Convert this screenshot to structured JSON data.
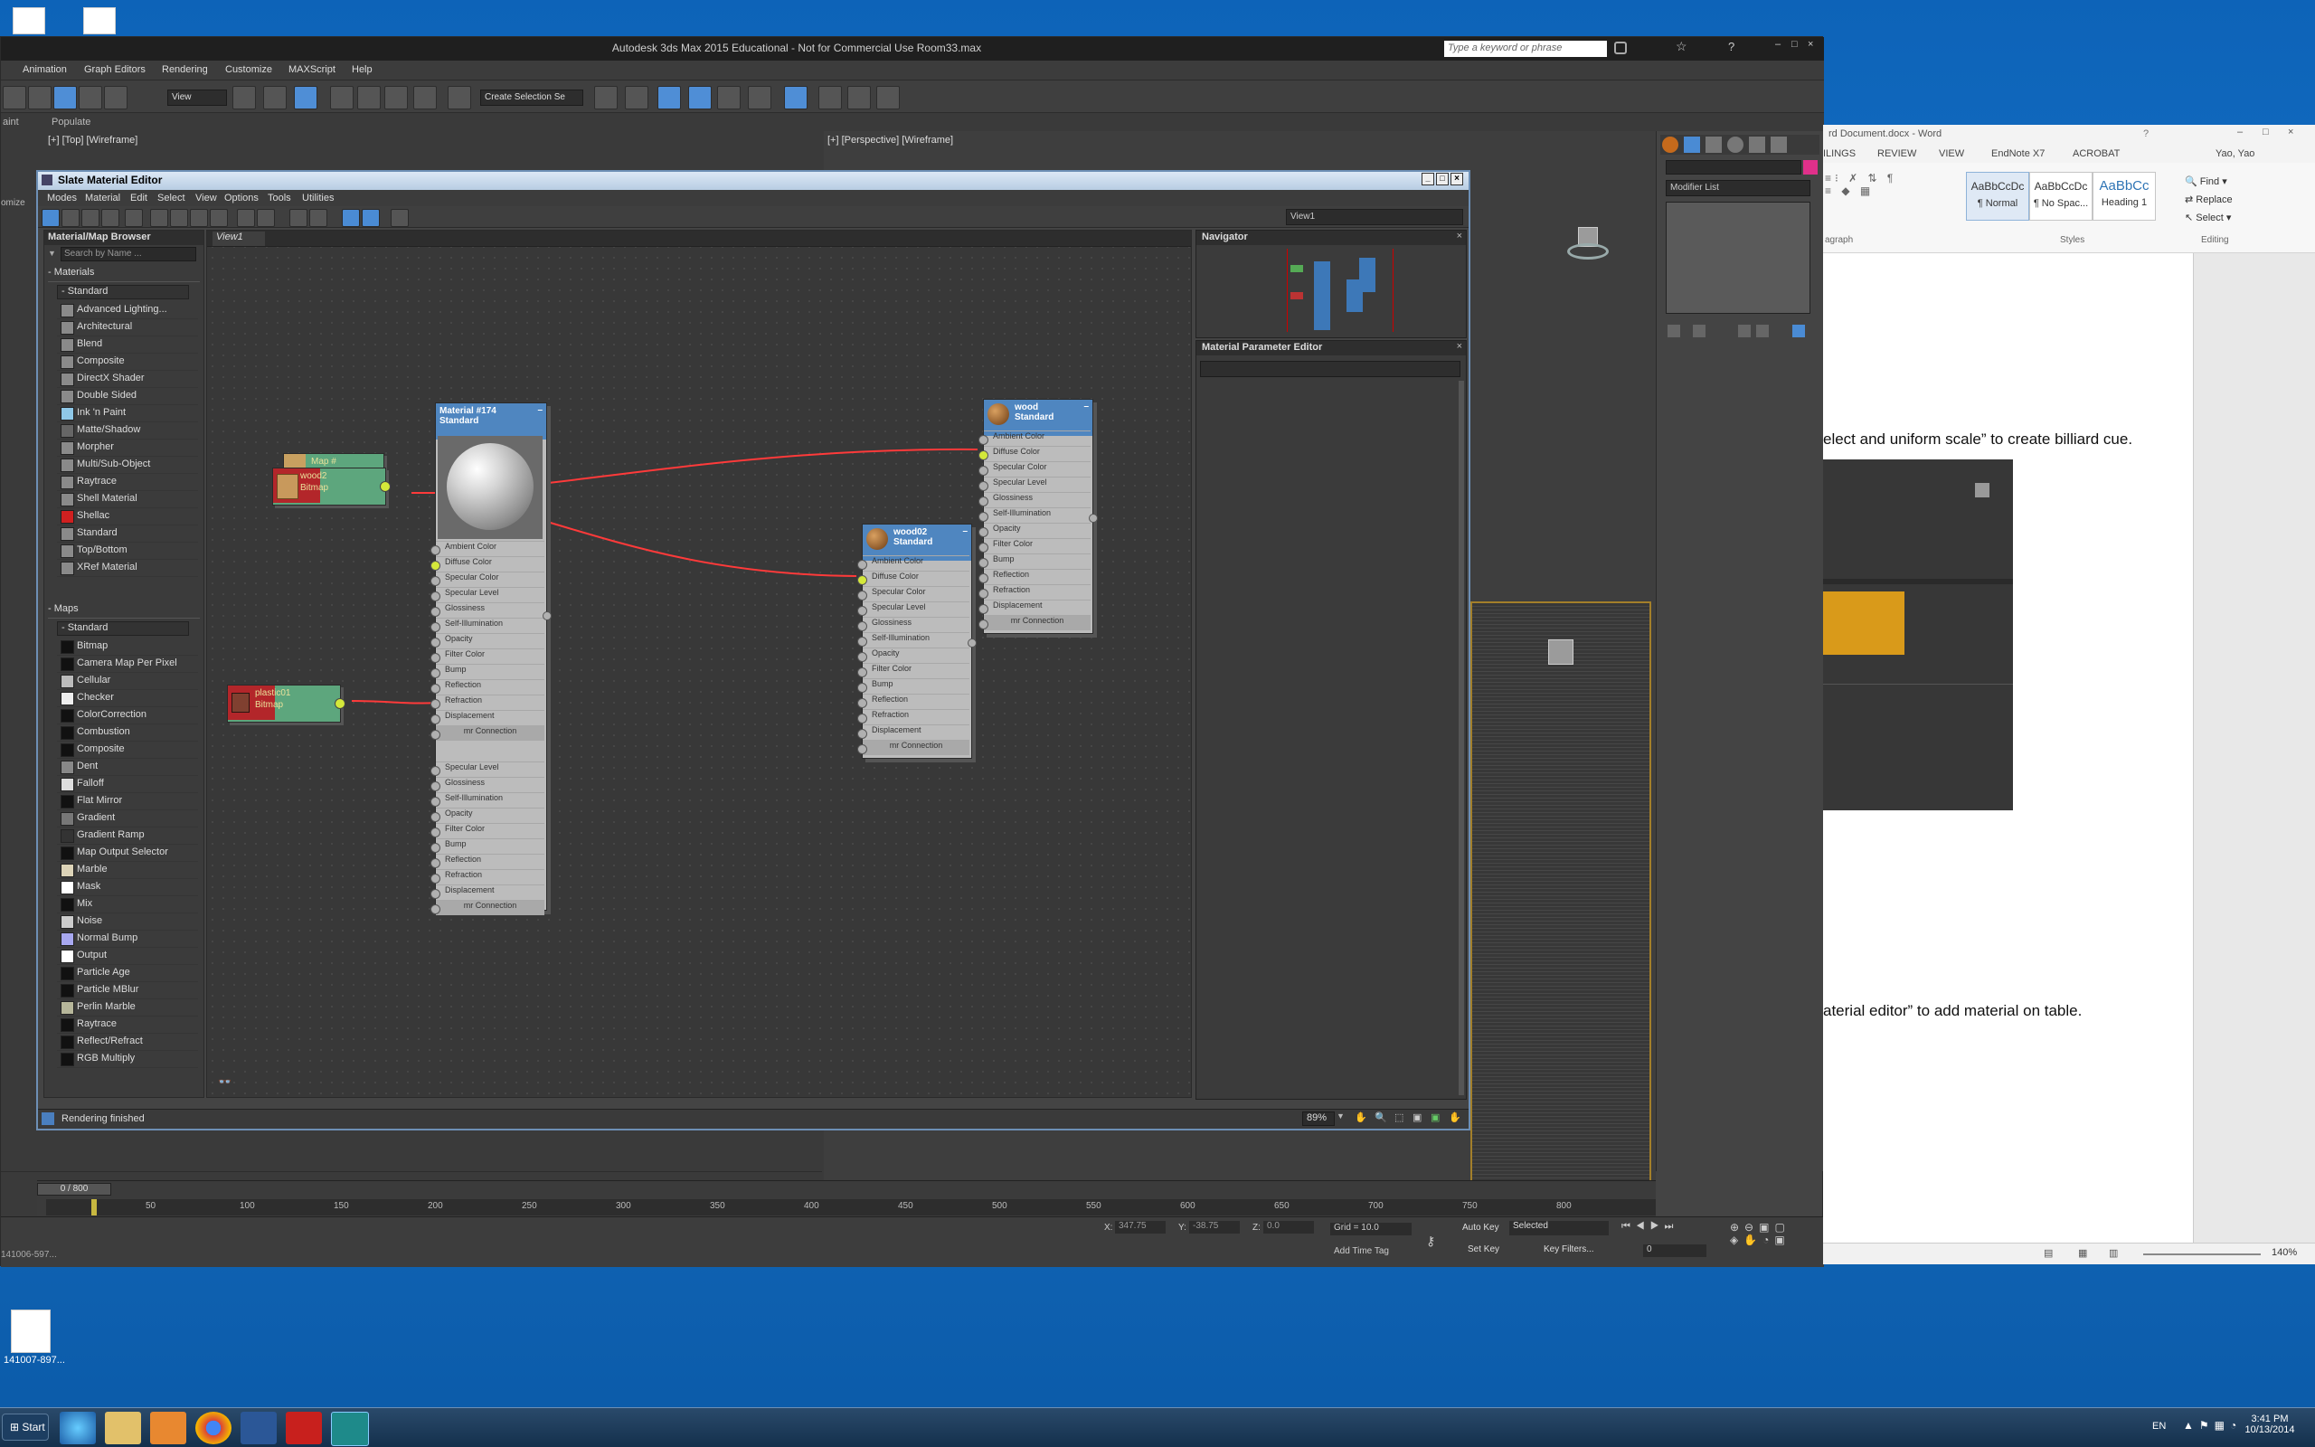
{
  "desktop": {
    "icons": [
      {
        "label": ""
      },
      {
        "label": ""
      },
      {
        "label": "141007-897..."
      }
    ]
  },
  "max": {
    "title": "Autodesk 3ds Max  2015  Educational - Not for Commercial Use    Room33.max",
    "search_placeholder": "Type a keyword or phrase",
    "menu": [
      "Animation",
      "Graph Editors",
      "Rendering",
      "Customize",
      "MAXScript",
      "Help"
    ],
    "ref_coord": "View",
    "selection_set": "Create Selection Se",
    "ribbon": [
      "aint",
      "Populate"
    ],
    "viewport_top_label": "[+] [Top] [Wireframe]",
    "viewport_persp_label": "[+] [Perspective] [Wireframe]",
    "side_label": "omize",
    "modifier_list": "Modifier List",
    "time_slider": "0 / 800",
    "ruler": [
      "50",
      "100",
      "150",
      "200",
      "250",
      "300",
      "350",
      "400",
      "450",
      "500",
      "550",
      "600",
      "650",
      "700",
      "750",
      "800"
    ],
    "status": {
      "x_label": "X:",
      "x_val": "347.75",
      "y_label": "Y:",
      "y_val": "-38.75",
      "z_label": "Z:",
      "z_val": "0.0",
      "grid": "Grid = 10.0",
      "auto_key": "Auto Key",
      "auto_key_val": "Selected",
      "set_key": "Set Key",
      "key_filters": "Key Filters...",
      "add_time_tag": "Add Time Tag",
      "frame": "0",
      "left_text": "141006-597..."
    }
  },
  "slate": {
    "title": "Slate Material Editor",
    "menu": [
      "Modes",
      "Material",
      "Edit",
      "Select",
      "View",
      "Options",
      "Tools",
      "Utilities"
    ],
    "view_dropdown": "View1",
    "browser": {
      "title": "Material/Map Browser",
      "search": "Search by Name ...",
      "materials_header": "- Materials",
      "materials_group": "- Standard",
      "materials": [
        {
          "name": "Advanced Lighting...",
          "color": "#8a8a8a"
        },
        {
          "name": "Architectural",
          "color": "#8a8a8a"
        },
        {
          "name": "Blend",
          "color": "#8a8a8a"
        },
        {
          "name": "Composite",
          "color": "#8a8a8a"
        },
        {
          "name": "DirectX Shader",
          "color": "#8a8a8a"
        },
        {
          "name": "Double Sided",
          "color": "#8a8a8a"
        },
        {
          "name": "Ink 'n Paint",
          "color": "#8fc8e8"
        },
        {
          "name": "Matte/Shadow",
          "color": "#666666"
        },
        {
          "name": "Morpher",
          "color": "#8a8a8a"
        },
        {
          "name": "Multi/Sub-Object",
          "color": "#8a8a8a"
        },
        {
          "name": "Raytrace",
          "color": "#8a8a8a"
        },
        {
          "name": "Shell Material",
          "color": "#8a8a8a"
        },
        {
          "name": "Shellac",
          "color": "#d02020"
        },
        {
          "name": "Standard",
          "color": "#8a8a8a"
        },
        {
          "name": "Top/Bottom",
          "color": "#8a8a8a"
        },
        {
          "name": "XRef Material",
          "color": "#8a8a8a"
        }
      ],
      "maps_header": "- Maps",
      "maps_group": "- Standard",
      "maps": [
        {
          "name": "Bitmap",
          "color": "#111111"
        },
        {
          "name": "Camera Map Per Pixel",
          "color": "#111111"
        },
        {
          "name": "Cellular",
          "color": "#bbbbbb"
        },
        {
          "name": "Checker",
          "color": "#eeeeee"
        },
        {
          "name": "ColorCorrection",
          "color": "#111111"
        },
        {
          "name": "Combustion",
          "color": "#111111"
        },
        {
          "name": "Composite",
          "color": "#111111"
        },
        {
          "name": "Dent",
          "color": "#888888"
        },
        {
          "name": "Falloff",
          "color": "#dddddd"
        },
        {
          "name": "Flat Mirror",
          "color": "#111111"
        },
        {
          "name": "Gradient",
          "color": "#777777"
        },
        {
          "name": "Gradient Ramp",
          "color": "#333333"
        },
        {
          "name": "Map Output Selector",
          "color": "#111111"
        },
        {
          "name": "Marble",
          "color": "#ddd4b8"
        },
        {
          "name": "Mask",
          "color": "#ffffff"
        },
        {
          "name": "Mix",
          "color": "#111111"
        },
        {
          "name": "Noise",
          "color": "#cccccc"
        },
        {
          "name": "Normal Bump",
          "color": "#a8a8f0"
        },
        {
          "name": "Output",
          "color": "#ffffff"
        },
        {
          "name": "Particle Age",
          "color": "#111111"
        },
        {
          "name": "Particle MBlur",
          "color": "#111111"
        },
        {
          "name": "Perlin Marble",
          "color": "#b6b69a"
        },
        {
          "name": "Raytrace",
          "color": "#111111"
        },
        {
          "name": "Reflect/Refract",
          "color": "#111111"
        },
        {
          "name": "RGB Multiply",
          "color": "#111111"
        }
      ]
    },
    "canvas_tab": "View1",
    "navigator_title": "Navigator",
    "mpe_title": "Material Parameter Editor",
    "status": "Rendering finished",
    "zoom": "89%",
    "nodes": {
      "mat174": {
        "title": "Material #174",
        "type": "Standard",
        "slots": [
          "Ambient Color",
          "Diffuse Color",
          "Specular Color",
          "Specular Level",
          "Glossiness",
          "Self-Illumination",
          "Opacity",
          "Filter Color",
          "Bump",
          "Reflection",
          "Refraction",
          "Displacement",
          "mr Connection"
        ],
        "slots2": [
          "Specular Level",
          "Glossiness",
          "Self-Illumination",
          "Opacity",
          "Filter Color",
          "Bump",
          "Reflection",
          "Refraction",
          "Displacement",
          "mr Connection"
        ]
      },
      "wood": {
        "title": "wood",
        "type": "Standard",
        "slots": [
          "Ambient Color",
          "Diffuse Color",
          "Specular Color",
          "Specular Level",
          "Glossiness",
          "Self-Illumination",
          "Opacity",
          "Filter Color",
          "Bump",
          "Reflection",
          "Refraction",
          "Displacement",
          "mr Connection"
        ]
      },
      "wood02": {
        "title": "wood02",
        "type": "Standard",
        "slots": [
          "Ambient Color",
          "Diffuse Color",
          "Specular Color",
          "Specular Level",
          "Glossiness",
          "Self-Illumination",
          "Opacity",
          "Filter Color",
          "Bump",
          "Reflection",
          "Refraction",
          "Displacement",
          "mr Connection"
        ]
      },
      "bitmap_wood": {
        "name": "wood2",
        "type": "Bitmap",
        "back": "Map #"
      },
      "bitmap_plastic": {
        "name": "plastic01",
        "type": "Bitmap"
      }
    }
  },
  "word": {
    "title": "rd Document.docx - Word",
    "tabs": [
      "ILINGS",
      "REVIEW",
      "VIEW",
      "EndNote X7",
      "ACROBAT"
    ],
    "user": "Yao, Yao",
    "styles": [
      {
        "preview": "AaBbCcDc",
        "name": "¶ Normal"
      },
      {
        "preview": "AaBbCcDc",
        "name": "¶ No Spac..."
      },
      {
        "preview": "AaBbCc",
        "name": "Heading 1"
      }
    ],
    "group_paragraph": "agraph",
    "group_styles": "Styles",
    "group_editing": "Editing",
    "find": "Find",
    "replace": "Replace",
    "select": "Select",
    "line1": "elect and uniform scale” to create billiard cue.",
    "line2": "aterial editor” to add material on table.",
    "zoom": "140%"
  },
  "taskbar": {
    "start": "Start",
    "lang": "EN",
    "time": "3:41 PM",
    "date": "10/13/2014"
  }
}
